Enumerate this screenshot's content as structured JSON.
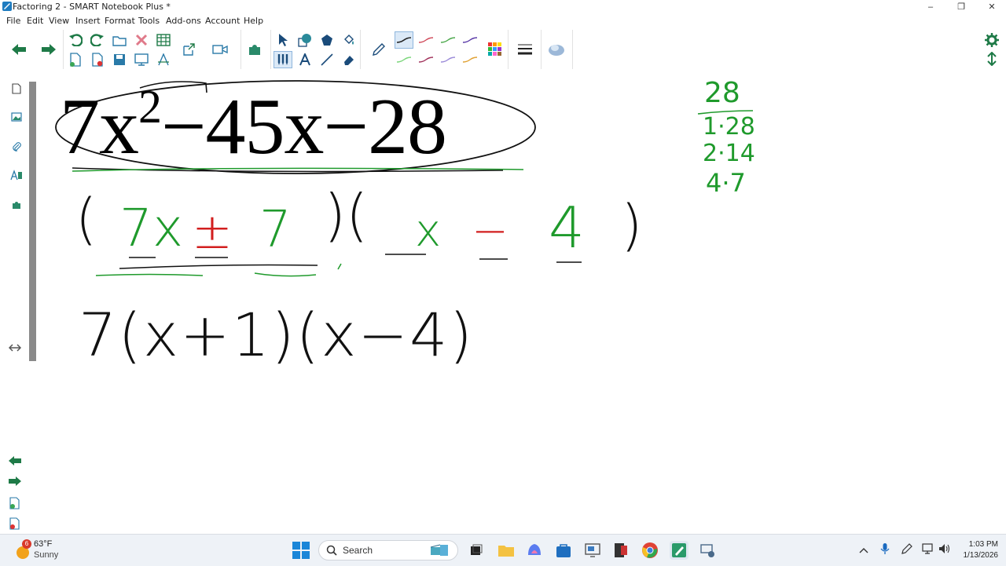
{
  "window": {
    "title": "Factoring 2 - SMART Notebook Plus *",
    "minimize_symbol": "–",
    "restore_symbol": "❐",
    "close_symbol": "✕"
  },
  "menu": [
    "File",
    "Edit",
    "View",
    "Insert",
    "Format",
    "Tools",
    "Add-ons",
    "Account",
    "Help"
  ],
  "canvas": {
    "printed_expression": {
      "a": "7x",
      "exp": "2",
      "rest": "−45x−28"
    },
    "factored_guess": {
      "open_paren": "(",
      "first_term": "7x",
      "first_sign": "±",
      "first_const": "7",
      "mid_paren": ")(",
      "second_term": "x",
      "second_sign": "−",
      "second_const": "4",
      "close_paren": ")"
    },
    "final_answer": "7(x+1)(x−4)",
    "factor_list": {
      "number": "28",
      "pairs": [
        "1·28",
        "2·14",
        "4·7"
      ]
    }
  },
  "taskbar": {
    "weather_badge": "6",
    "weather_temp": "63°F",
    "weather_desc": "Sunny",
    "search_label": "Search",
    "time": "1:03 PM",
    "date": "1/13/2026"
  },
  "colors": {
    "accent": "#1e7a47",
    "ink_green": "#1f9a2c",
    "ink_red": "#d21f1f",
    "taskbar_bg": "#eef2f7"
  }
}
